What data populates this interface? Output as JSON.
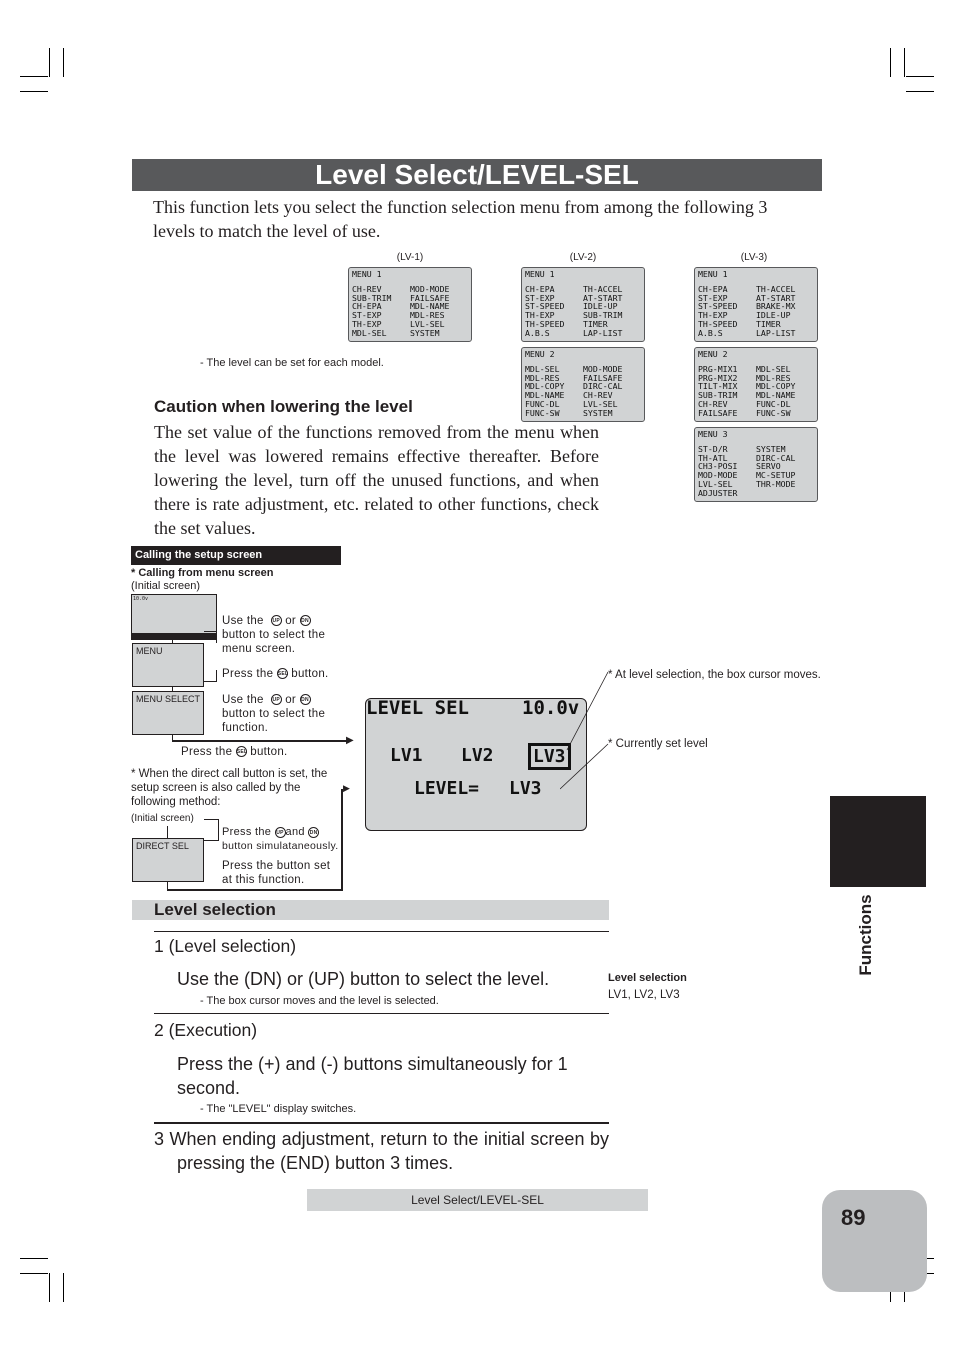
{
  "page": {
    "title": "Level Select/LEVEL-SEL",
    "intro": "This function lets you select the function selection menu from among the following 3 levels to match the level of use.",
    "level_note": "- The level can be set for each model.",
    "side_tab": "Functions",
    "footer": "Level Select/LEVEL-SEL",
    "page_number": "89"
  },
  "menus": {
    "lv1": {
      "label": "(LV-1)",
      "screens": [
        {
          "header": "MENU 1",
          "left": [
            "CH-REV",
            "SUB-TRIM",
            "CH-EPA",
            "ST-EXP",
            "TH-EXP",
            "MDL-SEL"
          ],
          "right": [
            "MOD-MODE",
            "FAILSAFE",
            "MDL-NAME",
            "MDL-RES",
            "LVL-SEL",
            "SYSTEM"
          ]
        }
      ]
    },
    "lv2": {
      "label": "(LV-2)",
      "screens": [
        {
          "header": "MENU 1",
          "left": [
            "CH-EPA",
            "ST-EXP",
            "ST-SPEED",
            "TH-EXP",
            "TH-SPEED",
            "A.B.S"
          ],
          "right": [
            "TH-ACCEL",
            "AT-START",
            "IDLE-UP",
            "SUB-TRIM",
            "TIMER",
            "LAP-LIST"
          ]
        },
        {
          "header": "MENU 2",
          "left": [
            "MDL-SEL",
            "MDL-RES",
            "MDL-COPY",
            "MDL-NAME",
            "FUNC-DL",
            "FUNC-SW"
          ],
          "right": [
            "MOD-MODE",
            "FAILSAFE",
            "DIRC-CAL",
            "CH-REV",
            "LVL-SEL",
            "SYSTEM"
          ]
        }
      ]
    },
    "lv3": {
      "label": "(LV-3)",
      "screens": [
        {
          "header": "MENU 1",
          "left": [
            "CH-EPA",
            "ST-EXP",
            "ST-SPEED",
            "TH-EXP",
            "TH-SPEED",
            "A.B.S"
          ],
          "right": [
            "TH-ACCEL",
            "AT-START",
            "BRAKE-MX",
            "IDLE-UP",
            "TIMER",
            "LAP-LIST"
          ]
        },
        {
          "header": "MENU 2",
          "left": [
            "PRG-MIX1",
            "PRG-MIX2",
            "TILT-MIX",
            "SUB-TRIM",
            "CH-REV",
            "FAILSAFE"
          ],
          "right": [
            "MDL-SEL",
            "MDL-RES",
            "MDL-COPY",
            "MDL-NAME",
            "FUNC-DL",
            "FUNC-SW"
          ]
        },
        {
          "header": "MENU 3",
          "left": [
            "ST-D/R",
            "TH-ATL",
            "CH3-POSI",
            "MOD-MODE",
            "LVL-SEL",
            "ADJUSTER"
          ],
          "right": [
            "SYSTEM",
            "DIRC-CAL",
            "SERVO",
            "MC-SETUP",
            "THR-MODE",
            ""
          ]
        }
      ]
    }
  },
  "caution": {
    "heading": "Caution when lowering the level",
    "body": "The set value of the functions removed from the menu when the level was lowered remains effective thereafter. Before lowering the level, turn off the unused functions, and when there is rate adjustment, etc. related to other functions, check the set values."
  },
  "setup": {
    "bar": "Calling the setup screen",
    "from_menu": "* Calling from menu screen",
    "initial_screen": "(Initial screen)",
    "menu_box": "MENU",
    "menu_select_box": "MENU SELECT",
    "direct_sel_box": "DIRECT SEL",
    "use_the": "Use the",
    "or": "or",
    "select_menu": "button to select the menu screen.",
    "press_the": "Press the",
    "button": "button.",
    "select_function": "button to select the function.",
    "direct_note": "* When the direct call button is set, the setup screen is also called by the following method:",
    "initial_screen2": "(Initial screen)",
    "and": "and",
    "simul": "button simulataneously.",
    "press_set": "Press the button set at this function.",
    "icons": {
      "up": "UP",
      "dn": "DN",
      "sel": "SEL"
    },
    "mini_lcd": {
      "top": "10.0v"
    }
  },
  "lcd": {
    "title": "LEVEL SEL",
    "voltage": "10.0v",
    "options": [
      "LV1",
      "LV2",
      "LV3"
    ],
    "selected": "LV3",
    "level_label": "LEVEL=",
    "level_value": "LV3",
    "note_cursor": "* At level selection, the box cursor moves.",
    "note_current": "* Currently set level"
  },
  "level_selection": {
    "heading": "Level selection",
    "step1_title": "1 (Level selection)",
    "step1_text": "Use the (DN) or (UP) button to select the level.",
    "step1_sub": "- The box cursor moves and the level is selected.",
    "step2_title": "2 (Execution)",
    "step2_text": "Press the (+) and (-) buttons simultaneously for 1 second.",
    "step2_sub": "- The \"LEVEL\" display switches.",
    "step3_text": "3 When ending adjustment, return to the initial screen by pressing the (END) button 3 times.",
    "side_heading": "Level selection",
    "side_values": "LV1, LV2, LV3"
  }
}
